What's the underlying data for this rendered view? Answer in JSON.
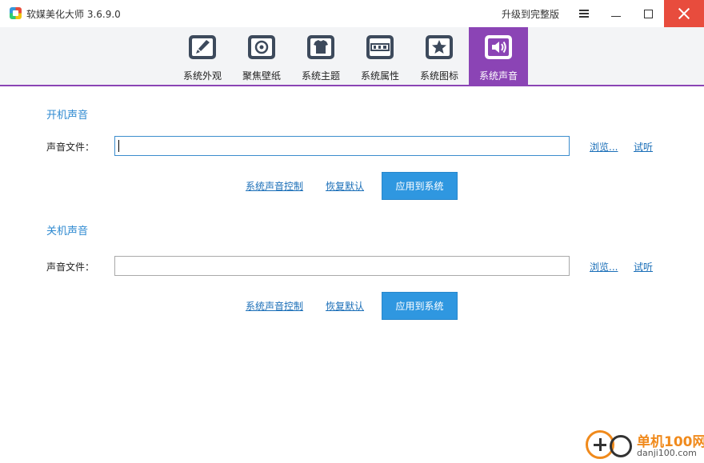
{
  "window": {
    "title": "软媒美化大师 3.6.9.0",
    "upgrade_label": "升级到完整版"
  },
  "toolbar": {
    "tabs": [
      {
        "label": "系统外观",
        "icon": "paintbrush-icon",
        "active": false
      },
      {
        "label": "聚焦壁纸",
        "icon": "wallpaper-icon",
        "active": false
      },
      {
        "label": "系统主题",
        "icon": "tshirt-icon",
        "active": false
      },
      {
        "label": "系统属性",
        "icon": "oem-icon",
        "active": false
      },
      {
        "label": "系统图标",
        "icon": "star-icon",
        "active": false
      },
      {
        "label": "系统声音",
        "icon": "speaker-icon",
        "active": true
      }
    ],
    "accent_color": "#8b44b5"
  },
  "startup": {
    "title": "开机声音",
    "field_label": "声音文件：",
    "file_value": "",
    "browse_label": "浏览...",
    "preview_label": "试听",
    "control_label": "系统声音控制",
    "restore_label": "恢复默认",
    "apply_label": "应用到系统"
  },
  "shutdown": {
    "title": "关机声音",
    "field_label": "声音文件：",
    "file_value": "",
    "browse_label": "浏览...",
    "preview_label": "试听",
    "control_label": "系统声音控制",
    "restore_label": "恢复默认",
    "apply_label": "应用到系统"
  },
  "watermark": {
    "brand": "单机100网",
    "domain": "danji100.com"
  },
  "colors": {
    "link": "#1b6fb8",
    "section_title": "#2f8ad1",
    "apply_button": "#2f97e0",
    "close_button": "#e84c3d"
  }
}
